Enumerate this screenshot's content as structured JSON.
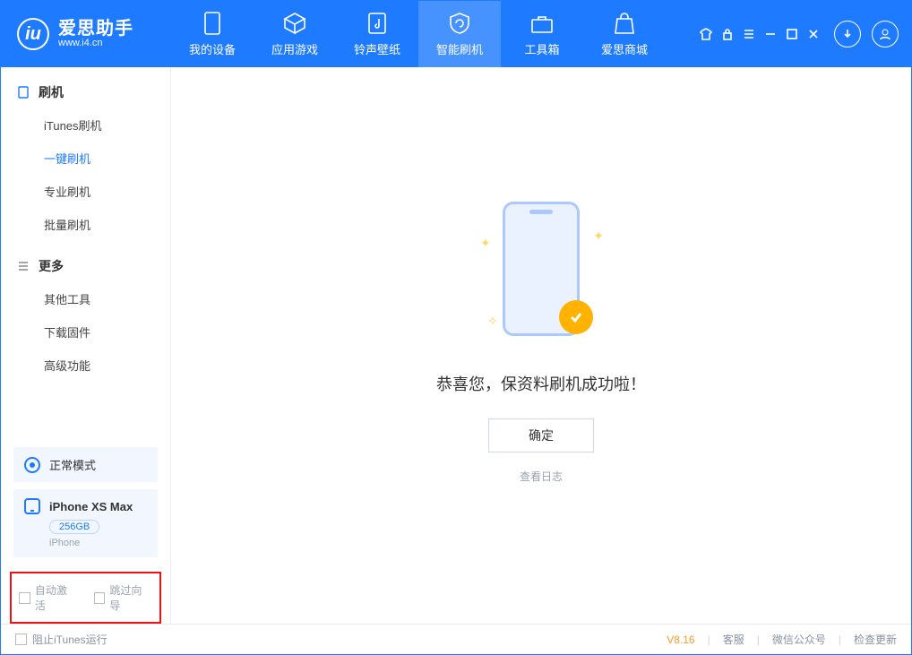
{
  "header": {
    "logo_title": "爱思助手",
    "logo_sub": "www.i4.cn",
    "nav": [
      {
        "label": "我的设备"
      },
      {
        "label": "应用游戏"
      },
      {
        "label": "铃声壁纸"
      },
      {
        "label": "智能刷机"
      },
      {
        "label": "工具箱"
      },
      {
        "label": "爱思商城"
      }
    ]
  },
  "sidebar": {
    "section1_title": "刷机",
    "items1": [
      {
        "label": "iTunes刷机"
      },
      {
        "label": "一键刷机"
      },
      {
        "label": "专业刷机"
      },
      {
        "label": "批量刷机"
      }
    ],
    "section2_title": "更多",
    "items2": [
      {
        "label": "其他工具"
      },
      {
        "label": "下载固件"
      },
      {
        "label": "高级功能"
      }
    ],
    "status_label": "正常模式",
    "device_name": "iPhone XS Max",
    "storage": "256GB",
    "device_type": "iPhone",
    "checkbox_auto_activate": "自动激活",
    "checkbox_skip_guide": "跳过向导"
  },
  "main": {
    "success_message": "恭喜您，保资料刷机成功啦！",
    "ok_button": "确定",
    "view_log": "查看日志"
  },
  "footer": {
    "block_itunes": "阻止iTunes运行",
    "version": "V8.16",
    "support": "客服",
    "wechat": "微信公众号",
    "check_update": "检查更新"
  }
}
